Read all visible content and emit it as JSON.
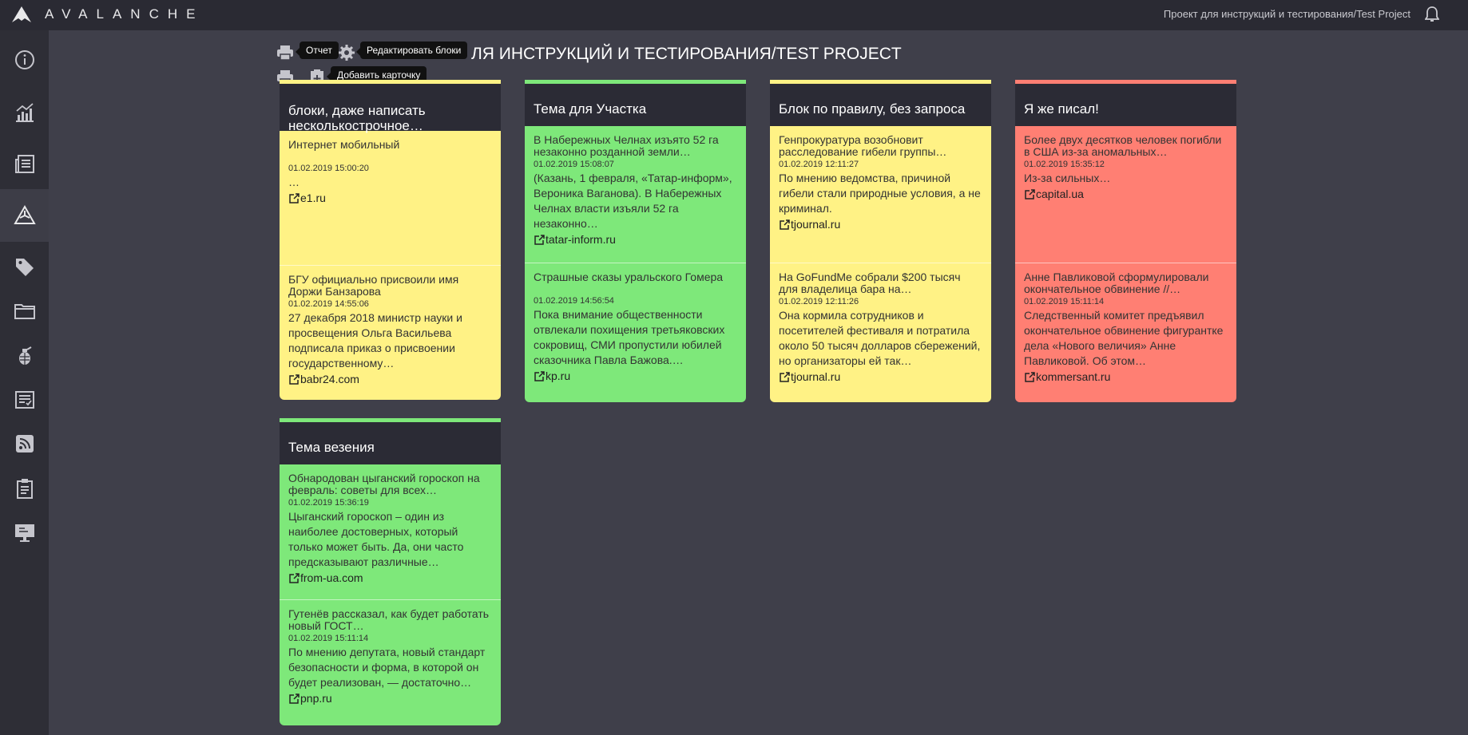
{
  "topbar": {
    "brand": "AVALANCHE",
    "project": "Проект для инструкций и тестирования/Test Project"
  },
  "sidebar": {
    "items": [
      {
        "icon": "info-icon"
      },
      {
        "icon": "analytics-icon"
      },
      {
        "icon": "news-icon"
      },
      {
        "icon": "avalanche-icon",
        "active": true
      },
      {
        "icon": "tag-icon"
      },
      {
        "icon": "folder-icon"
      },
      {
        "icon": "grenade-icon"
      },
      {
        "icon": "checklist-icon"
      },
      {
        "icon": "rss-icon"
      },
      {
        "icon": "clipboard-icon"
      },
      {
        "icon": "monitor-icon"
      }
    ]
  },
  "toolbar": {
    "title_visible": "ЛЯ ИНСТРУКЦИЙ И ТЕСТИРОВАНИЯ/TEST PROJECT",
    "tooltip_report": "Отчет",
    "tooltip_edit_blocks": "Редактировать блоки",
    "tooltip_add_card": "Добавить карточку"
  },
  "colors": {
    "yellow": "#fff285",
    "green": "#7ee87a",
    "red": "#ff7f73",
    "header": "#2b2b35"
  },
  "cards": [
    {
      "title": "блоки, даже написать несколькострочное…",
      "color": "yellow",
      "items": [
        {
          "title": "Интернет мобильный",
          "date": "01.02.2019 15:00:20",
          "text": "…",
          "source": "e1.ru"
        },
        {
          "title": "БГУ официально присвоили имя Доржи Банзарова",
          "date": "01.02.2019 14:55:06",
          "text": "27 декабря 2018 министр науки и просвещения Ольга Васильева подписала приказ о присвоении государственному…",
          "source": "babr24.com"
        }
      ]
    },
    {
      "title": "Тема для Участка",
      "color": "green",
      "items": [
        {
          "title": "В Набережных Челнах изъято 52 га незаконно розданной земли…",
          "date": "01.02.2019 15:08:07",
          "text": "(Казань, 1 февраля, «Татар-информ», Вероника Ваганова). В Набережных Челнах власти изъяли 52 га незаконно…",
          "source": "tatar-inform.ru"
        },
        {
          "title": "Страшные сказы уральского Гомера",
          "date": "01.02.2019 14:56:54",
          "text": "Пока внимание общественности отвлекали похищения третьяковских сокровищ, СМИ пропустили юбилей сказочника Павла Бажова.…",
          "source": "kp.ru"
        }
      ]
    },
    {
      "title": "Блок по правилу, без запроса",
      "color": "yellow",
      "items": [
        {
          "title": "Генпрокуратура возобновит расследование гибели группы…",
          "date": "01.02.2019 12:11:27",
          "text": "По мнению ведомства, причиной гибели стали природные условия, а не криминал.",
          "source": "tjournal.ru"
        },
        {
          "title": "На GoFundMe собрали $200 тысяч для владелица бара на…",
          "date": "01.02.2019 12:11:26",
          "text": "Она кормила сотрудников и посетителей фестиваля и потратила около 50 тысяч долларов сбережений, но организаторы ей так…",
          "source": "tjournal.ru"
        }
      ]
    },
    {
      "title": "Я же писал!",
      "color": "red",
      "items": [
        {
          "title": "Более двух десятков человек погибли в США из-за аномальных…",
          "date": "01.02.2019 15:35:12",
          "text": "Из-за сильных…",
          "source": "capital.ua"
        },
        {
          "title": "Анне Павликовой сформулировали окончательное обвинение //…",
          "date": "01.02.2019 15:11:14",
          "text": "Следственный комитет предъявил окончательное обвинение фигурантке дела «Нового величия» Анне Павликовой. Об этом…",
          "source": "kommersant.ru"
        }
      ]
    },
    {
      "title": "Тема везения",
      "color": "green",
      "items": [
        {
          "title": "Обнародован цыганский гороскоп на февраль: советы для всех…",
          "date": "01.02.2019 15:36:19",
          "text": "Цыганский гороскоп – один из наиболее достоверных, который только может быть. Да, они часто предсказывают различные…",
          "source": "from-ua.com"
        },
        {
          "title": "Гутенёв рассказал, как будет работать новый ГОСТ…",
          "date": "01.02.2019 15:11:14",
          "text": "По мнению депутата, новый стандарт безопасности и форма, в которой он будет реализован, — достаточно…",
          "source": "pnp.ru"
        }
      ]
    }
  ]
}
